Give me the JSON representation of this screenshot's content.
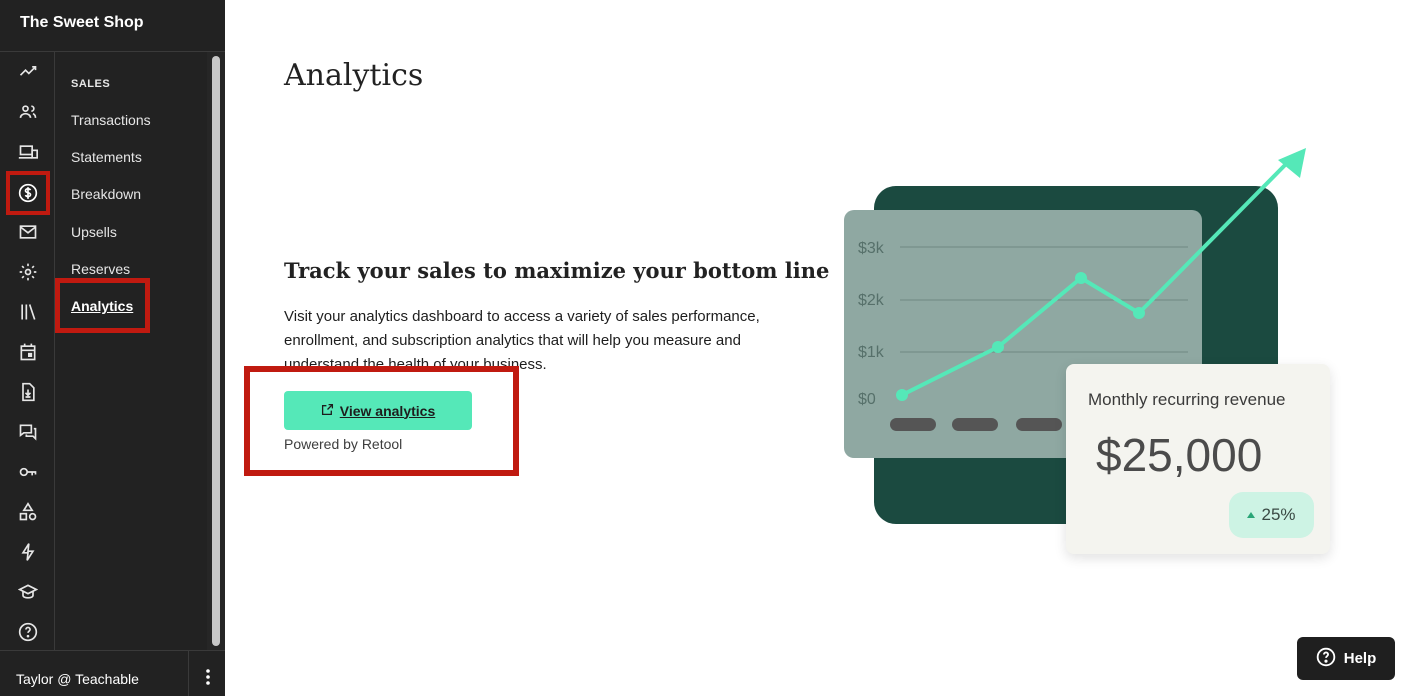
{
  "app": {
    "brand": "The Sweet Shop"
  },
  "icon_rail": [
    {
      "icon": "trend-line-icon"
    },
    {
      "icon": "users-icon"
    },
    {
      "icon": "devices-icon"
    },
    {
      "icon": "dollar-icon",
      "active": true
    },
    {
      "icon": "mail-icon"
    },
    {
      "icon": "gear-icon"
    },
    {
      "icon": "library-icon"
    },
    {
      "icon": "calendar-icon"
    },
    {
      "icon": "download-file-icon"
    },
    {
      "icon": "comments-icon"
    },
    {
      "icon": "key-icon"
    },
    {
      "icon": "shapes-icon"
    },
    {
      "icon": "lightning-icon"
    },
    {
      "icon": "graduation-cap-icon"
    },
    {
      "icon": "help-circle-icon"
    }
  ],
  "sub_nav": {
    "section": "SALES",
    "items": [
      {
        "label": "Transactions"
      },
      {
        "label": "Statements"
      },
      {
        "label": "Breakdown"
      },
      {
        "label": "Upsells"
      },
      {
        "label": "Reserves"
      },
      {
        "label": "Analytics",
        "current": true
      }
    ]
  },
  "user": {
    "name": "Taylor @ Teachable"
  },
  "main": {
    "title": "Analytics",
    "headline": "Track your sales to maximize your bottom line",
    "description": "Visit your analytics dashboard to access a variety of sales performance, enrollment, and subscription analytics that will help you measure and understand the health of your business.",
    "cta_label": "View analytics",
    "powered_by": "Powered by Retool"
  },
  "illustration": {
    "y_ticks": [
      "$3k",
      "$2k",
      "$1k",
      "$0"
    ],
    "card_title": "Monthly recurring revenue",
    "card_value": "$25,000",
    "change": "25%",
    "colors": {
      "accent": "#55e8b8",
      "dark_panel": "#1b4a40",
      "chart_panel": "#8fa8a2"
    }
  },
  "help": {
    "label": "Help"
  },
  "colors": {
    "sidebar": "#222222",
    "highlight": "#c01a10"
  }
}
